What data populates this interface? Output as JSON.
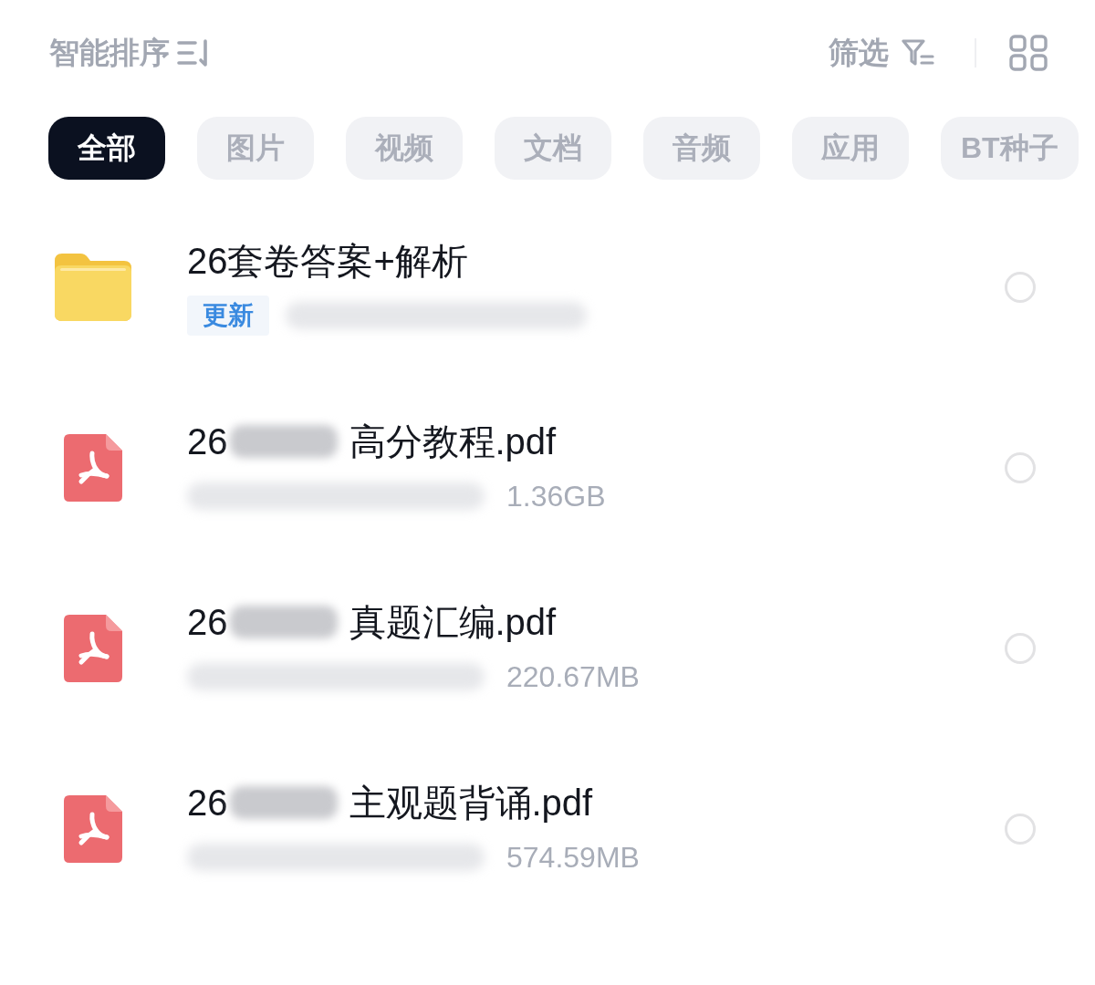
{
  "toolbar": {
    "sort_label": "智能排序",
    "filter_label": "筛选"
  },
  "tabs": [
    {
      "label": "全部",
      "selected": true
    },
    {
      "label": "图片",
      "selected": false
    },
    {
      "label": "视频",
      "selected": false
    },
    {
      "label": "文档",
      "selected": false
    },
    {
      "label": "音频",
      "selected": false
    },
    {
      "label": "应用",
      "selected": false
    },
    {
      "label": "BT种子",
      "selected": false
    }
  ],
  "files": [
    {
      "kind": "folder",
      "name_parts": [
        "26套卷答案+解析"
      ],
      "badge": "更新",
      "selected": false
    },
    {
      "kind": "pdf",
      "name_parts": [
        "26",
        "高分教程.pdf"
      ],
      "size": "1.36GB",
      "selected": false
    },
    {
      "kind": "pdf",
      "name_parts": [
        "26",
        "真题汇编.pdf"
      ],
      "size": "220.67MB",
      "selected": false
    },
    {
      "kind": "pdf",
      "name_parts": [
        "26",
        "主观题背诵.pdf"
      ],
      "size": "574.59MB",
      "selected": false
    }
  ]
}
